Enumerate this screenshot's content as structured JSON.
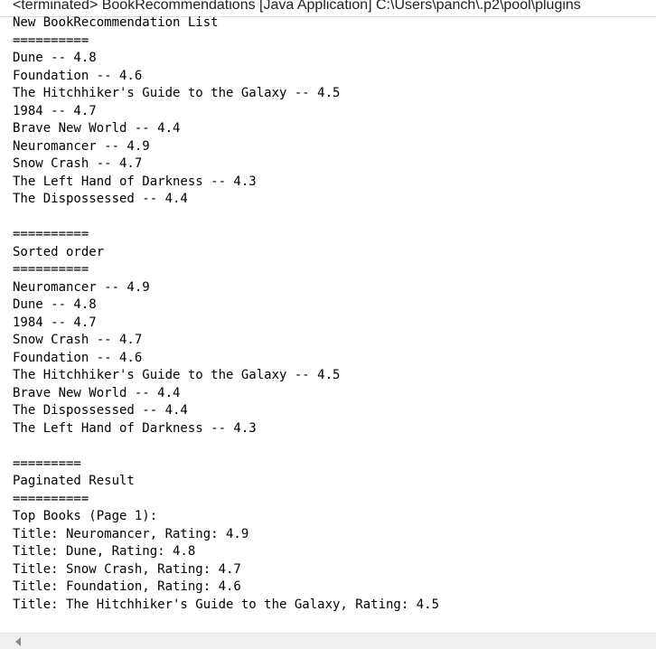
{
  "window": {
    "title": "<terminated> BookRecommendations [Java Application] C:\\Users\\panch\\.p2\\pool\\plugins"
  },
  "console": {
    "lines": [
      "New BookRecommendation List",
      "==========",
      "Dune -- 4.8",
      "Foundation -- 4.6",
      "The Hitchhiker's Guide to the Galaxy -- 4.5",
      "1984 -- 4.7",
      "Brave New World -- 4.4",
      "Neuromancer -- 4.9",
      "Snow Crash -- 4.7",
      "The Left Hand of Darkness -- 4.3",
      "The Dispossessed -- 4.4",
      "",
      "==========",
      "Sorted order",
      "==========",
      "Neuromancer -- 4.9",
      "Dune -- 4.8",
      "1984 -- 4.7",
      "Snow Crash -- 4.7",
      "Foundation -- 4.6",
      "The Hitchhiker's Guide to the Galaxy -- 4.5",
      "Brave New World -- 4.4",
      "The Dispossessed -- 4.4",
      "The Left Hand of Darkness -- 4.3",
      "",
      "=========",
      "Paginated Result",
      "==========",
      "Top Books (Page 1):",
      "Title: Neuromancer, Rating: 4.9",
      "Title: Dune, Rating: 4.8",
      "Title: Snow Crash, Rating: 4.7",
      "Title: Foundation, Rating: 4.6",
      "Title: The Hitchhiker's Guide to the Galaxy, Rating: 4.5"
    ]
  },
  "scrollbar": {
    "left_icon": "chevron-left-icon"
  }
}
